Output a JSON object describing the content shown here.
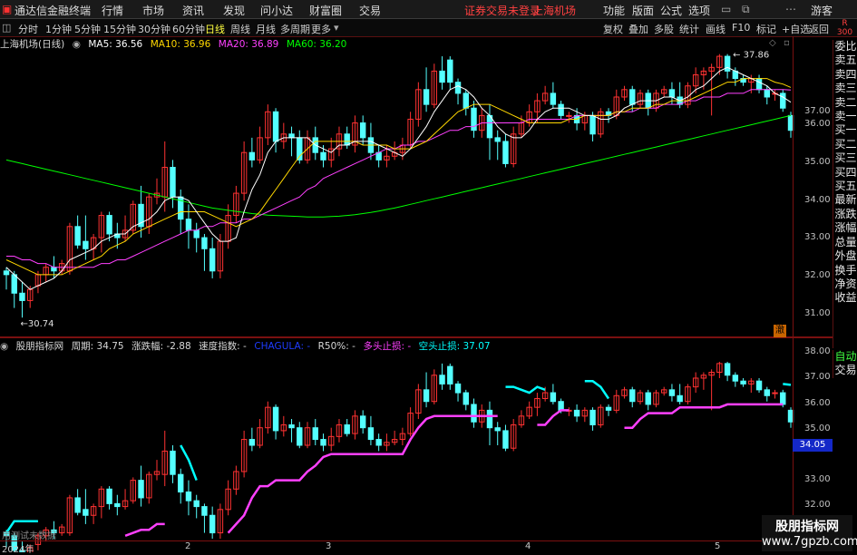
{
  "menubar": {
    "app_title": "通达信金融终端",
    "items": [
      "行情",
      "市场",
      "资讯",
      "发现",
      "问小达",
      "财富圈",
      "交易"
    ],
    "notice": "证券交易未登录",
    "stock": "上海机场",
    "right_items": [
      "功能",
      "版面",
      "公式",
      "选项"
    ],
    "guest": "游客"
  },
  "periodbar": {
    "periods": [
      "分时",
      "1分钟",
      "5分钟",
      "15分钟",
      "30分钟",
      "60分钟",
      "日线",
      "周线",
      "月线",
      "多周期",
      "更多"
    ],
    "active_period": "日线",
    "tools": [
      "复权",
      "叠加",
      "多股",
      "统计",
      "画线",
      "F10",
      "标记",
      "+自选",
      "返回"
    ]
  },
  "main_info": {
    "title": "上海机场(日线)",
    "ma5": "MA5: 36.56",
    "ma10": "MA10: 36.96",
    "ma20": "MA20: 36.89",
    "ma60": "MA60: 36.20",
    "colors": {
      "ma5": "#ffffff",
      "ma10": "#ffd700",
      "ma20": "#ff40ff",
      "ma60": "#00ff00"
    }
  },
  "ind_info": {
    "title": "股朋指标网",
    "period": "周期: 34.75",
    "change": "涨跌幅: -2.88",
    "speed": "速度指数: -",
    "code": "CHAGULA: -",
    "r50": "R50%: -",
    "long_stop": "多头止损: -",
    "short_stop": "空头止损: 37.07",
    "colors": {
      "code": "#1428c8",
      "long": "#ff40ff",
      "short": "#00ffff"
    }
  },
  "main_yaxis": [
    "37.00",
    "36.00",
    "35.00",
    "34.00",
    "33.00",
    "32.00",
    "31.00"
  ],
  "ind_yaxis": [
    "38.00",
    "37.00",
    "36.00",
    "35.00",
    "34.00",
    "33.00",
    "32.00"
  ],
  "current_price": "34.05",
  "annotations": {
    "high": "37.86",
    "low": "30.74",
    "marker": "澈"
  },
  "right_tabs": [
    "委比",
    "卖五",
    "卖四",
    "卖三",
    "卖二",
    "卖一",
    "买一",
    "买二",
    "买三",
    "买四",
    "买五",
    "最新",
    "涨跌",
    "涨幅",
    "总量",
    "外盘",
    "换手",
    "净资",
    "收益"
  ],
  "right_tabs2": [
    "自动",
    "交易"
  ],
  "r_label": "R",
  "r_number": "300",
  "xaxis": {
    "year": "2024年",
    "months": [
      "2",
      "3",
      "4",
      "5"
    ]
  },
  "footer_text": "用测试未数据",
  "watermark": {
    "name": "股朋指标网",
    "url": "www.7gpzb.com"
  },
  "chart_data": {
    "type": "candlestick",
    "up_color": "#ff3232",
    "down_color": "#54ffff",
    "candles": [
      [
        32.0,
        31.9,
        32.1,
        31.5
      ],
      [
        31.9,
        31.4,
        32.0,
        31.0
      ],
      [
        31.4,
        31.2,
        31.7,
        30.74
      ],
      [
        31.2,
        31.5,
        31.6,
        31.0
      ],
      [
        31.6,
        31.9,
        32.0,
        31.4
      ],
      [
        31.9,
        32.1,
        32.2,
        31.7
      ],
      [
        32.1,
        32.0,
        32.4,
        31.8
      ],
      [
        32.0,
        32.2,
        32.3,
        31.9
      ],
      [
        32.0,
        33.2,
        33.3,
        31.9
      ],
      [
        33.2,
        32.7,
        33.5,
        32.6
      ],
      [
        32.8,
        32.6,
        33.5,
        32.3
      ],
      [
        32.6,
        32.9,
        33.0,
        32.3
      ],
      [
        32.9,
        33.5,
        33.6,
        32.5
      ],
      [
        33.5,
        33.0,
        33.6,
        32.8
      ],
      [
        33.0,
        32.9,
        33.3,
        32.6
      ],
      [
        32.9,
        33.1,
        33.5,
        32.8
      ],
      [
        33.1,
        33.8,
        33.9,
        33.0
      ],
      [
        33.8,
        33.2,
        34.3,
        32.9
      ],
      [
        33.2,
        34.0,
        34.1,
        33.0
      ],
      [
        34.0,
        34.1,
        34.5,
        33.8
      ],
      [
        34.0,
        34.8,
        35.5,
        33.6
      ],
      [
        34.8,
        34.0,
        35.0,
        33.7
      ],
      [
        34.0,
        33.4,
        34.2,
        33.0
      ],
      [
        33.4,
        33.1,
        33.8,
        32.6
      ],
      [
        33.1,
        32.9,
        33.3,
        32.5
      ],
      [
        32.9,
        32.6,
        33.0,
        32.0
      ],
      [
        32.6,
        32.0,
        32.9,
        31.8
      ],
      [
        32.0,
        32.8,
        33.0,
        31.8
      ],
      [
        32.8,
        33.5,
        33.8,
        32.6
      ],
      [
        33.5,
        34.1,
        34.3,
        33.3
      ],
      [
        34.1,
        35.2,
        35.5,
        33.9
      ],
      [
        35.2,
        35.0,
        35.6,
        34.8
      ],
      [
        35.0,
        35.6,
        35.9,
        34.9
      ],
      [
        35.6,
        36.3,
        36.5,
        35.4
      ],
      [
        36.3,
        35.5,
        36.4,
        35.2
      ],
      [
        35.5,
        35.7,
        36.0,
        35.3
      ],
      [
        35.7,
        35.6,
        35.9,
        35.1
      ],
      [
        35.6,
        35.0,
        35.8,
        34.9
      ],
      [
        35.0,
        35.6,
        35.8,
        34.9
      ],
      [
        35.6,
        35.2,
        35.9,
        35.0
      ],
      [
        35.2,
        35.0,
        35.4,
        34.8
      ],
      [
        35.0,
        35.3,
        35.6,
        34.8
      ],
      [
        35.3,
        35.7,
        35.9,
        35.1
      ],
      [
        35.7,
        35.4,
        35.9,
        35.3
      ],
      [
        35.4,
        36.0,
        36.2,
        35.2
      ],
      [
        36.0,
        35.6,
        36.2,
        35.4
      ],
      [
        35.6,
        35.2,
        36.0,
        35.0
      ],
      [
        35.2,
        35.0,
        35.4,
        34.8
      ],
      [
        35.0,
        35.1,
        35.4,
        34.8
      ],
      [
        35.1,
        35.2,
        35.5,
        35.0
      ],
      [
        35.2,
        35.4,
        35.6,
        35.0
      ],
      [
        35.4,
        36.1,
        36.3,
        35.3
      ],
      [
        36.1,
        36.9,
        37.1,
        35.9
      ],
      [
        36.9,
        36.5,
        37.5,
        36.3
      ],
      [
        36.5,
        37.4,
        37.6,
        36.4
      ],
      [
        37.4,
        37.1,
        37.8,
        36.9
      ],
      [
        37.7,
        37.1,
        37.8,
        36.9
      ],
      [
        37.1,
        36.8,
        37.2,
        36.5
      ],
      [
        36.8,
        36.4,
        36.9,
        36.2
      ],
      [
        36.4,
        35.8,
        36.6,
        35.6
      ],
      [
        35.8,
        36.2,
        36.4,
        35.6
      ],
      [
        36.2,
        35.6,
        36.5,
        35.0
      ],
      [
        35.6,
        35.5,
        35.8,
        35.0
      ],
      [
        35.5,
        34.9,
        35.7,
        34.8
      ],
      [
        34.9,
        35.7,
        35.9,
        34.8
      ],
      [
        35.7,
        36.0,
        36.2,
        35.6
      ],
      [
        36.0,
        36.3,
        36.5,
        35.9
      ],
      [
        36.3,
        36.6,
        36.8,
        36.0
      ],
      [
        36.6,
        36.8,
        37.0,
        36.5
      ],
      [
        36.8,
        36.5,
        37.1,
        36.4
      ],
      [
        36.5,
        36.2,
        36.6,
        36.1
      ],
      [
        36.2,
        36.2,
        36.3,
        36.0
      ],
      [
        36.2,
        36.0,
        36.4,
        35.8
      ],
      [
        36.0,
        36.2,
        36.3,
        35.8
      ],
      [
        36.2,
        35.7,
        36.3,
        35.5
      ],
      [
        35.7,
        36.3,
        36.4,
        35.6
      ],
      [
        36.3,
        36.2,
        36.4,
        36.0
      ],
      [
        36.2,
        36.7,
        36.9,
        36.1
      ],
      [
        36.7,
        36.9,
        37.0,
        36.6
      ],
      [
        36.9,
        36.5,
        37.0,
        36.3
      ],
      [
        36.5,
        36.8,
        36.9,
        36.4
      ],
      [
        36.8,
        36.4,
        36.9,
        36.2
      ],
      [
        36.4,
        36.8,
        36.9,
        36.3
      ],
      [
        36.8,
        36.9,
        37.0,
        36.7
      ],
      [
        36.9,
        36.7,
        37.1,
        36.5
      ],
      [
        36.7,
        36.5,
        37.1,
        36.4
      ],
      [
        36.5,
        37.0,
        37.1,
        36.4
      ],
      [
        37.0,
        37.3,
        37.5,
        36.8
      ],
      [
        37.3,
        37.4,
        37.5,
        36.9
      ],
      [
        37.4,
        37.5,
        37.6,
        36.2
      ],
      [
        37.5,
        37.8,
        37.86,
        37.3
      ],
      [
        37.8,
        37.4,
        37.86,
        37.2
      ],
      [
        37.4,
        37.2,
        37.5,
        37.0
      ],
      [
        37.2,
        37.1,
        37.3,
        37.0
      ],
      [
        37.1,
        37.2,
        37.3,
        36.8
      ],
      [
        37.2,
        36.9,
        37.3,
        36.8
      ],
      [
        36.9,
        36.7,
        37.0,
        36.5
      ],
      [
        36.8,
        36.8,
        36.9,
        36.6
      ],
      [
        36.8,
        36.4,
        36.9,
        36.3
      ],
      [
        36.2,
        35.8,
        36.3,
        35.6
      ]
    ],
    "ma5": [
      32.1,
      31.9,
      31.7,
      31.5,
      31.6,
      31.7,
      31.8,
      32.0,
      32.3,
      32.4,
      32.5,
      32.6,
      32.8,
      32.9,
      33.0,
      33.0,
      33.2,
      33.3,
      33.4,
      33.6,
      33.9,
      34.0,
      34.0,
      33.9,
      33.6,
      33.3,
      33.0,
      32.8,
      32.8,
      32.9,
      33.6,
      34.2,
      34.6,
      35.2,
      35.5,
      35.6,
      35.6,
      35.6,
      35.6,
      35.4,
      35.3,
      35.2,
      35.4,
      35.4,
      35.5,
      35.5,
      35.5,
      35.4,
      35.3,
      35.2,
      35.1,
      35.3,
      35.6,
      35.9,
      36.3,
      36.6,
      36.9,
      37.0,
      36.9,
      36.7,
      36.4,
      36.2,
      35.9,
      35.7,
      35.6,
      35.6,
      35.8,
      36.1,
      36.3,
      36.4,
      36.4,
      36.4,
      36.3,
      36.2,
      36.2,
      36.1,
      36.1,
      36.2,
      36.4,
      36.5,
      36.6,
      36.6,
      36.6,
      36.7,
      36.7,
      36.6,
      36.7,
      36.9,
      37.0,
      37.2,
      37.4,
      37.5,
      37.4,
      37.3,
      37.2,
      37.1,
      37.0,
      36.8,
      36.7,
      36.56
    ],
    "ma10": [
      32.3,
      32.2,
      32.1,
      32.0,
      31.9,
      31.9,
      31.9,
      31.9,
      32.0,
      32.1,
      32.2,
      32.3,
      32.4,
      32.6,
      32.7,
      32.8,
      33.0,
      33.1,
      33.2,
      33.3,
      33.4,
      33.5,
      33.6,
      33.6,
      33.6,
      33.6,
      33.5,
      33.4,
      33.3,
      33.2,
      33.3,
      33.4,
      33.6,
      33.9,
      34.2,
      34.5,
      34.8,
      35.1,
      35.3,
      35.5,
      35.5,
      35.5,
      35.5,
      35.5,
      35.5,
      35.4,
      35.4,
      35.4,
      35.4,
      35.3,
      35.3,
      35.3,
      35.4,
      35.5,
      35.7,
      35.9,
      36.1,
      36.3,
      36.4,
      36.5,
      36.5,
      36.5,
      36.4,
      36.3,
      36.2,
      36.1,
      36.0,
      36.0,
      36.0,
      36.0,
      36.0,
      36.1,
      36.1,
      36.2,
      36.2,
      36.2,
      36.2,
      36.3,
      36.3,
      36.4,
      36.4,
      36.4,
      36.5,
      36.5,
      36.6,
      36.6,
      36.6,
      36.7,
      36.8,
      36.9,
      37.0,
      37.1,
      37.1,
      37.2,
      37.2,
      37.2,
      37.2,
      37.1,
      37.05,
      36.96
    ],
    "ma20": [
      32.4,
      32.4,
      32.3,
      32.3,
      32.2,
      32.2,
      32.1,
      32.1,
      32.1,
      32.1,
      32.1,
      32.1,
      32.2,
      32.2,
      32.3,
      32.3,
      32.4,
      32.5,
      32.6,
      32.7,
      32.8,
      32.9,
      33.0,
      33.1,
      33.1,
      33.2,
      33.2,
      33.3,
      33.3,
      33.3,
      33.4,
      33.4,
      33.5,
      33.6,
      33.7,
      33.8,
      33.9,
      34.0,
      34.2,
      34.3,
      34.5,
      34.6,
      34.7,
      34.8,
      34.9,
      35.0,
      35.1,
      35.2,
      35.3,
      35.3,
      35.4,
      35.4,
      35.5,
      35.5,
      35.6,
      35.7,
      35.8,
      35.8,
      35.9,
      35.9,
      36.0,
      36.0,
      36.0,
      36.0,
      36.0,
      36.0,
      36.1,
      36.1,
      36.1,
      36.1,
      36.1,
      36.1,
      36.2,
      36.2,
      36.2,
      36.2,
      36.2,
      36.3,
      36.3,
      36.3,
      36.4,
      36.4,
      36.4,
      36.5,
      36.5,
      36.5,
      36.6,
      36.6,
      36.7,
      36.7,
      36.7,
      36.8,
      36.8,
      36.8,
      36.9,
      36.9,
      36.9,
      36.9,
      36.9,
      36.89
    ],
    "ma60": [
      35.0,
      34.95,
      34.9,
      34.85,
      34.8,
      34.75,
      34.7,
      34.65,
      34.6,
      34.55,
      34.5,
      34.45,
      34.4,
      34.35,
      34.3,
      34.25,
      34.2,
      34.15,
      34.1,
      34.05,
      34.0,
      33.95,
      33.9,
      33.85,
      33.8,
      33.75,
      33.7,
      33.67,
      33.64,
      33.61,
      33.58,
      33.55,
      33.53,
      33.51,
      33.5,
      33.49,
      33.48,
      33.47,
      33.46,
      33.46,
      33.46,
      33.47,
      33.48,
      33.5,
      33.52,
      33.55,
      33.58,
      33.62,
      33.66,
      33.7,
      33.75,
      33.8,
      33.85,
      33.9,
      33.95,
      34.0,
      34.05,
      34.1,
      34.15,
      34.2,
      34.25,
      34.3,
      34.35,
      34.4,
      34.45,
      34.5,
      34.55,
      34.6,
      34.65,
      34.7,
      34.75,
      34.8,
      34.85,
      34.9,
      34.95,
      35.0,
      35.05,
      35.1,
      35.15,
      35.2,
      35.25,
      35.3,
      35.35,
      35.4,
      35.45,
      35.5,
      35.55,
      35.6,
      35.65,
      35.7,
      35.75,
      35.8,
      35.85,
      35.9,
      35.95,
      36.0,
      36.05,
      36.1,
      36.15,
      36.2
    ],
    "main_ylim": [
      30.5,
      37.9
    ],
    "ind_ylim": [
      31.8,
      38.2
    ],
    "long_stop": [
      null,
      null,
      null,
      null,
      null,
      null,
      null,
      null,
      null,
      null,
      null,
      null,
      null,
      null,
      null,
      31.9,
      32.0,
      32.1,
      32.1,
      32.3,
      32.3,
      null,
      null,
      null,
      null,
      null,
      null,
      null,
      32.0,
      32.3,
      32.6,
      33.2,
      33.6,
      33.6,
      33.8,
      33.8,
      33.8,
      33.8,
      34.1,
      34.3,
      34.6,
      34.7,
      34.7,
      34.7,
      34.7,
      34.7,
      34.7,
      34.7,
      34.7,
      34.7,
      34.7,
      35.2,
      35.6,
      35.9,
      36.0,
      36.0,
      36.0,
      36.0,
      36.0,
      36.0,
      36.0,
      36.0,
      36.0,
      null,
      null,
      null,
      null,
      35.7,
      35.7,
      36.0,
      36.2,
      36.2,
      null,
      null,
      null,
      null,
      null,
      null,
      35.6,
      35.6,
      35.9,
      36.1,
      36.1,
      36.1,
      36.1,
      36.3,
      36.3,
      36.3,
      36.3,
      36.3,
      36.3,
      36.4,
      36.4,
      36.4,
      36.4,
      36.4,
      36.4,
      36.4,
      36.4,
      null
    ],
    "short_stop": [
      32.0,
      32.4,
      32.4,
      32.4,
      32.4,
      null,
      null,
      null,
      null,
      null,
      null,
      null,
      null,
      null,
      null,
      null,
      null,
      null,
      null,
      null,
      null,
      null,
      35.0,
      34.5,
      33.8,
      null,
      null,
      null,
      null,
      null,
      null,
      null,
      null,
      null,
      null,
      null,
      null,
      null,
      null,
      null,
      null,
      null,
      null,
      null,
      null,
      null,
      null,
      null,
      null,
      null,
      null,
      null,
      null,
      null,
      null,
      null,
      null,
      null,
      null,
      null,
      null,
      null,
      null,
      37.0,
      37.0,
      36.9,
      36.8,
      37.0,
      36.9,
      null,
      null,
      null,
      null,
      37.2,
      37.2,
      37.0,
      36.6,
      null,
      null,
      null,
      null,
      null,
      null,
      null,
      null,
      null,
      null,
      null,
      null,
      null,
      null,
      null,
      null,
      null,
      null,
      null,
      null,
      null,
      37.1,
      37.07
    ]
  }
}
